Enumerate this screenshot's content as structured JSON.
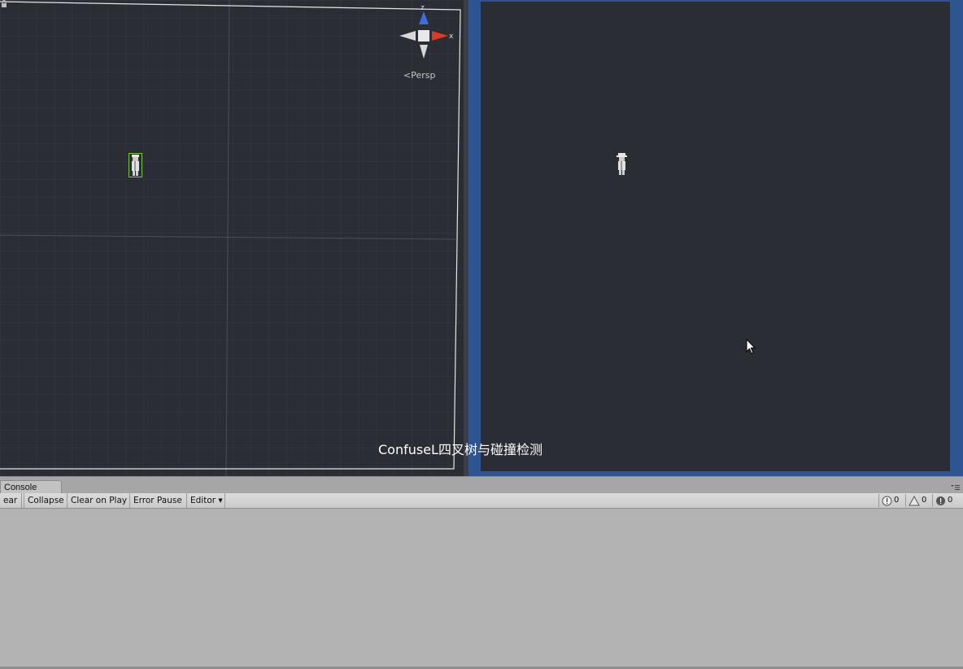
{
  "scene": {
    "gizmo": {
      "projection_label": "Persp",
      "axis_z": "z",
      "axis_x": "x"
    }
  },
  "caption": "ConfuseL四叉树与碰撞检测",
  "console": {
    "tab_label": "Console",
    "toolbar": {
      "clear_label": "ear",
      "collapse_label": "Collapse",
      "clear_on_play_label": "Clear on Play",
      "error_pause_label": "Error Pause",
      "editor_label": "Editor"
    },
    "counts": {
      "info": "0",
      "warnings": "0",
      "errors": "0"
    }
  },
  "colors": {
    "scene_background": "#2a2d34",
    "game_frame": "#2e5592",
    "selection_outline": "#7ec83a",
    "axis_z": "#3a6fe0",
    "axis_x": "#e03a22"
  },
  "icons": [
    "lock-icon",
    "scene-gizmo-icon",
    "character-icon",
    "cursor-icon",
    "tab-menu-icon",
    "info-icon",
    "warning-icon",
    "error-icon"
  ]
}
